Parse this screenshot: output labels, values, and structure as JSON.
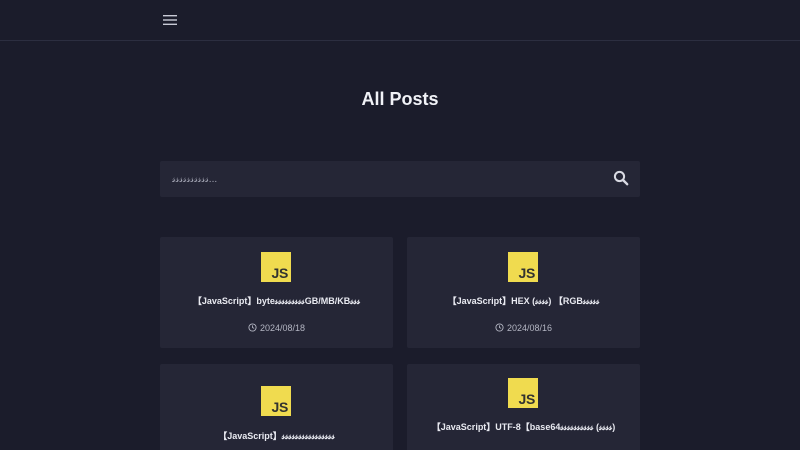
{
  "header": {
    "menu_icon": "hamburger-menu-icon"
  },
  "page": {
    "title": "All Posts"
  },
  "search": {
    "placeholder": "𝓈𝓈𝓈𝓈𝓈𝓈𝓈𝓈𝓈𝓈...",
    "icon": "search-icon"
  },
  "posts": [
    {
      "logo": "JS",
      "title": "【JavaScript】byte𝓈𝓈𝓈𝓈𝓈𝓈𝓈𝓈𝓈GB/MB/KB𝓈𝓈𝓈",
      "date": "2024/08/18"
    },
    {
      "logo": "JS",
      "title": "【JavaScript】HEX (𝓈𝓈𝓈𝓈) 【RGB𝓈𝓈𝓈𝓈𝓈",
      "date": "2024/08/16"
    },
    {
      "logo": "JS",
      "title": "【JavaScript】𝓈𝓈𝓈𝓈𝓈𝓈𝓈𝓈𝓈𝓈𝓈𝓈𝓈𝓈𝓈𝓈",
      "date": ""
    },
    {
      "logo": "JS",
      "title": "【JavaScript】UTF-8【base64𝓈𝓈𝓈𝓈𝓈𝓈𝓈𝓈𝓈𝓈 (𝓈𝓈𝓈𝓈)",
      "date": ""
    }
  ],
  "colors": {
    "background": "#1b1c2b",
    "card": "#252636",
    "js_yellow": "#f0db4f"
  }
}
